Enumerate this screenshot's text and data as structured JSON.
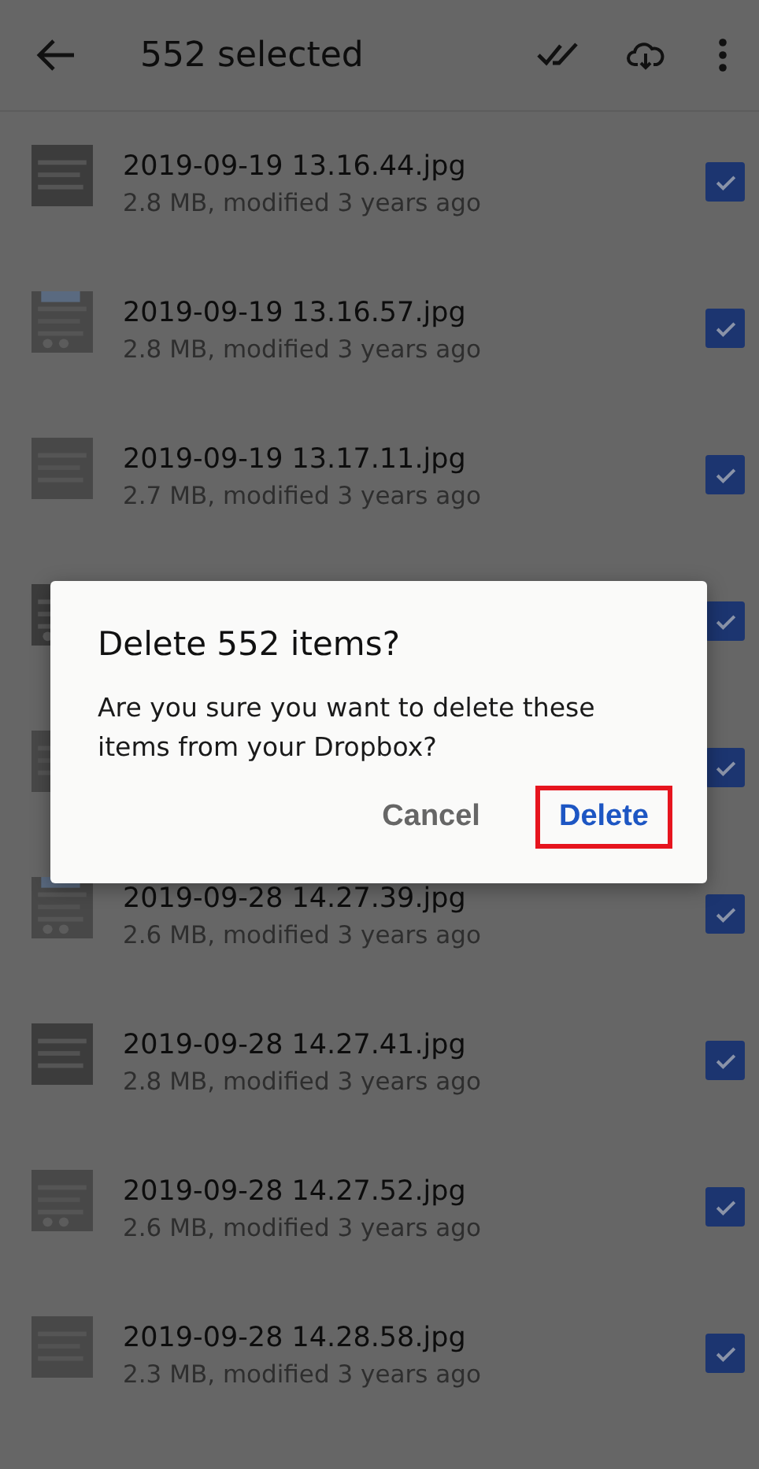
{
  "header": {
    "title": "552 selected"
  },
  "files": [
    {
      "name": "2019-09-19 13.16.44.jpg",
      "details": "2.8 MB, modified 3 years ago",
      "checked": true
    },
    {
      "name": "2019-09-19 13.16.57.jpg",
      "details": "2.8 MB, modified 3 years ago",
      "checked": true
    },
    {
      "name": "2019-09-19 13.17.11.jpg",
      "details": "2.7 MB, modified 3 years ago",
      "checked": true
    },
    {
      "checked": true
    },
    {
      "checked": true
    },
    {
      "name": "2019-09-28 14.27.39.jpg",
      "details": "2.6 MB, modified 3 years ago",
      "checked": true
    },
    {
      "name": "2019-09-28 14.27.41.jpg",
      "details": "2.8 MB, modified 3 years ago",
      "checked": true
    },
    {
      "name": "2019-09-28 14.27.52.jpg",
      "details": "2.6 MB, modified 3 years ago",
      "checked": true
    },
    {
      "name": "2019-09-28 14.28.58.jpg",
      "details": "2.3 MB, modified 3 years ago",
      "checked": true
    }
  ],
  "dialog": {
    "title": "Delete 552 items?",
    "message": "Are you sure you want to delete these items from your Dropbox?",
    "buttons": [
      {
        "label": "Cancel",
        "kind": "secondary",
        "highlighted": false
      },
      {
        "label": "Delete",
        "kind": "primary",
        "highlighted": true
      }
    ]
  }
}
